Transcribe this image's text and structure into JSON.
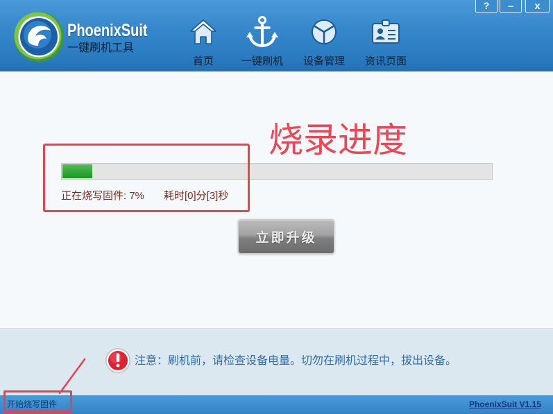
{
  "app": {
    "title": "PhoenixSuit",
    "subtitle": "一键刷机工具"
  },
  "window_controls": {
    "help": "?",
    "minimize": "–",
    "close": "x"
  },
  "nav": [
    {
      "label": "首页",
      "icon": "home-icon"
    },
    {
      "label": "一键刷机",
      "icon": "anchor-icon"
    },
    {
      "label": "设备管理",
      "icon": "cube-icon"
    },
    {
      "label": "资讯页面",
      "icon": "id-card-icon"
    }
  ],
  "annotations": {
    "heading": "烧录进度",
    "color": "#ef4655"
  },
  "flash": {
    "progress_percent": 7,
    "status_text": "正在烧写固件: 7%",
    "elapsed_text": "耗时[0]分[3]秒",
    "fill_color": "#1aa320"
  },
  "upgrade_button": {
    "label": "立即升级"
  },
  "notice": {
    "icon": "warning-icon",
    "text": "注意：刷机前，请检查设备电量。切勿在刷机过程中，拔出设备。"
  },
  "status_bar": {
    "status_text": "开始烧写固件",
    "version_link": "PhoenixSuit V1.15"
  },
  "colors": {
    "progress_text": "#7a2c1d",
    "notice_text": "#2f6db0",
    "header": "#2f80c4"
  }
}
